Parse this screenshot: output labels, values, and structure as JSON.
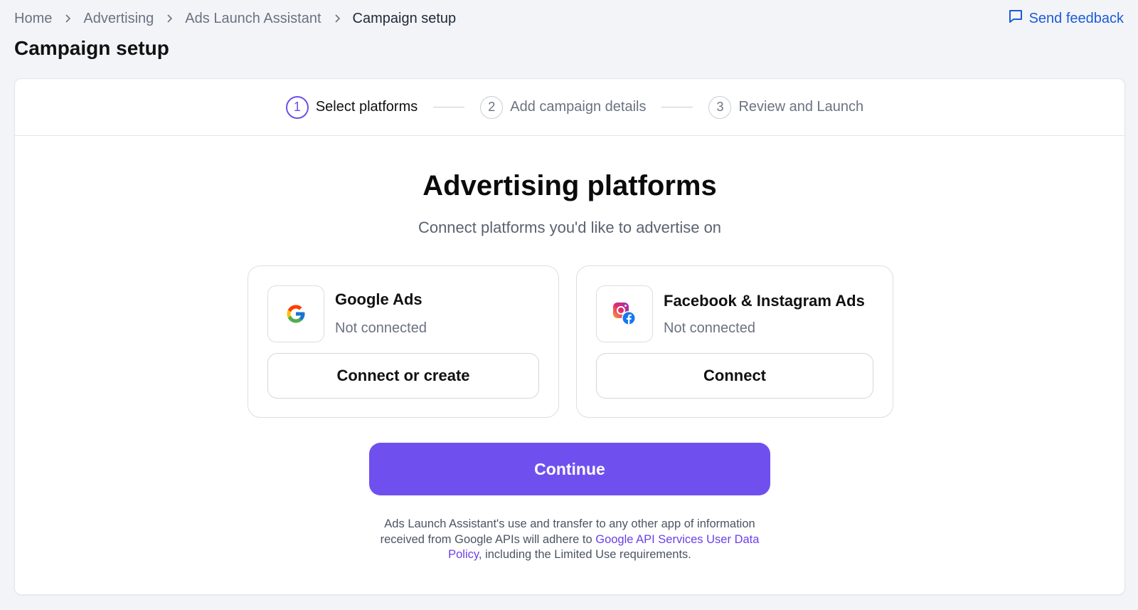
{
  "breadcrumb": {
    "items": [
      "Home",
      "Advertising",
      "Ads Launch Assistant",
      "Campaign setup"
    ]
  },
  "feedback": {
    "label": "Send feedback",
    "icon": "chat-icon"
  },
  "page": {
    "title": "Campaign setup"
  },
  "stepper": {
    "steps": [
      {
        "num": "1",
        "label": "Select platforms",
        "state": "active"
      },
      {
        "num": "2",
        "label": "Add campaign details",
        "state": "inactive"
      },
      {
        "num": "3",
        "label": "Review and Launch",
        "state": "inactive"
      }
    ]
  },
  "content": {
    "title": "Advertising platforms",
    "subtitle": "Connect platforms you'd like to advertise on"
  },
  "platforms": [
    {
      "name": "Google Ads",
      "status": "Not connected",
      "button": "Connect or create",
      "icon": "google-icon"
    },
    {
      "name": "Facebook & Instagram Ads",
      "status": "Not connected",
      "button": "Connect",
      "icon": "instagram-facebook-icon"
    }
  ],
  "continue_label": "Continue",
  "disclaimer": {
    "before": "Ads Launch Assistant's use and transfer to any other app of information received from Google APIs will adhere to ",
    "link": "Google API Services User Data Policy",
    "after": ", including the Limited Use requirements."
  },
  "colors": {
    "accent": "#6f50ef",
    "link": "#1c5bd8",
    "background": "#f3f4f8"
  }
}
